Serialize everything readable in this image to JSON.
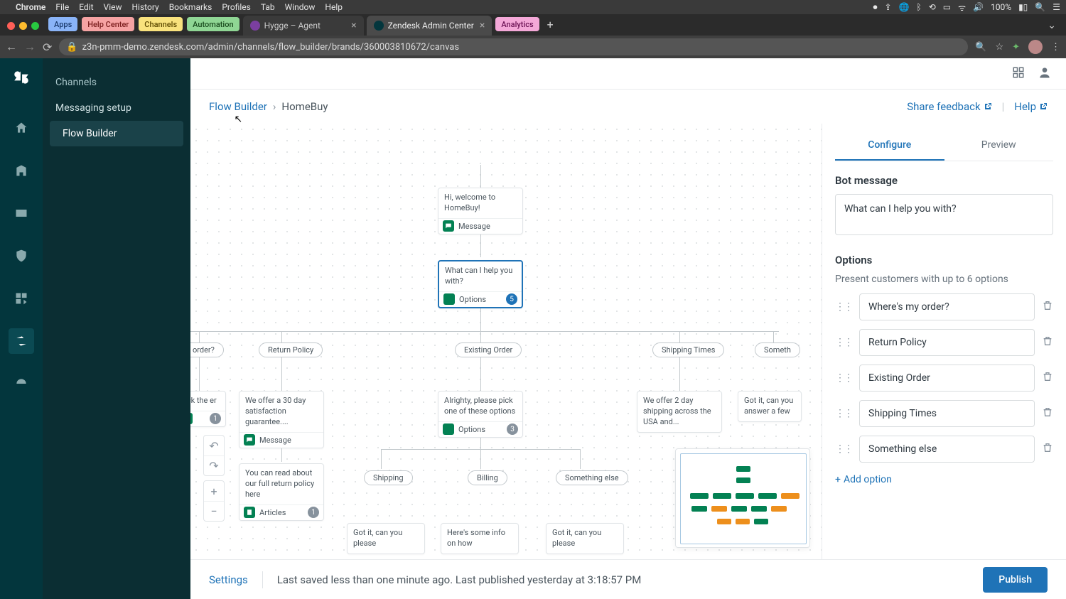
{
  "macos": {
    "app": "Chrome",
    "menus": [
      "File",
      "Edit",
      "View",
      "History",
      "Bookmarks",
      "Profiles",
      "Tab",
      "Window",
      "Help"
    ],
    "battery": "100%"
  },
  "chrome": {
    "pills": {
      "apps": "Apps",
      "helpcenter": "Help Center",
      "channels": "Channels",
      "automation": "Automation",
      "analytics": "Analytics"
    },
    "tabs": [
      {
        "title": "Hygge – Agent",
        "active": false
      },
      {
        "title": "Zendesk Admin Center",
        "active": true
      }
    ],
    "url": "z3n-pmm-demo.zendesk.com/admin/channels/flow_builder/brands/360003810672/canvas"
  },
  "sidebar": {
    "items": [
      "Channels",
      "Messaging setup",
      "Flow Builder"
    ],
    "active": 2
  },
  "breadcrumb": {
    "root": "Flow Builder",
    "current": "HomeBuy"
  },
  "headerlinks": {
    "feedback": "Share feedback",
    "help": "Help"
  },
  "canvas": {
    "welcome": {
      "text": "Hi, welcome to HomeBuy!",
      "footer": "Message"
    },
    "prompt": {
      "text": "What can I help you with?",
      "footer": "Options",
      "count": "5"
    },
    "pills": [
      "order?",
      "Return Policy",
      "Existing Order",
      "Shipping Times",
      "Someth"
    ],
    "sub": [
      {
        "text": "eck the er",
        "footer": "",
        "count": "1"
      },
      {
        "text": "We offer a 30 day satisfaction guarantee....",
        "footer": "Message"
      },
      {
        "text": "Alrighty, please pick one of these options",
        "footer": "Options",
        "count": "3"
      },
      {
        "text": "We offer 2 day shipping across the USA and...",
        "footer": ""
      },
      {
        "text": "Got it, can you answer a few ",
        "footer": ""
      }
    ],
    "articles": {
      "text": "You can read about our full return policy here",
      "footer": "Articles",
      "count": "1"
    },
    "subpills": [
      "Shipping",
      "Billing",
      "Something else"
    ],
    "peek": [
      "Got it, can you please",
      "Here's some info on how",
      "Got it, can you please"
    ]
  },
  "panel": {
    "tabs": [
      "Configure",
      "Preview"
    ],
    "botmsg_label": "Bot message",
    "botmsg_value": "What can I help you with?",
    "options_label": "Options",
    "options_desc": "Present customers with up to 6 options",
    "options": [
      "Where's my order?",
      "Return Policy",
      "Existing Order",
      "Shipping Times",
      "Something else"
    ],
    "add": "Add option"
  },
  "footer": {
    "settings": "Settings",
    "status": "Last saved less than one minute ago. Last published yesterday at 3:18:57 PM",
    "publish": "Publish"
  }
}
